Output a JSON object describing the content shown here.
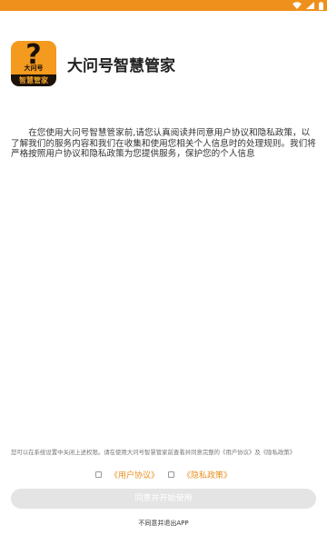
{
  "status_bar": {
    "color": "#f0901c",
    "icons": [
      "wifi-icon",
      "signal-icon",
      "battery-icon"
    ]
  },
  "app": {
    "logo_mark": "?",
    "logo_small_text": "大问号",
    "logo_band_text": "智慧管家",
    "name": "大问号智慧管家"
  },
  "agreement": {
    "body": "在您使用大问号智慧管家前,请您认真阅读并同意用户协议和隐私政策，以了解我们的服务内容和我们在收集和使用您相关个人信息时的处理规则。我们将严格按照用户协议和隐私政策为您提供服务，保护您的个人信息"
  },
  "footer": {
    "note": "您可以在系统设置中关闭上述权限。请在使用大问号智慧管家前查看并同意完整的《用户协议》及《隐私政策》",
    "user_agreement_label": "《用户协议》",
    "privacy_policy_label": "《隐私政策》",
    "agree_button_label": "同意并开始使用",
    "exit_label": "不同意并退出APP",
    "accent_color": "#e8901e",
    "button_disabled_color": "#e4e4e4"
  }
}
